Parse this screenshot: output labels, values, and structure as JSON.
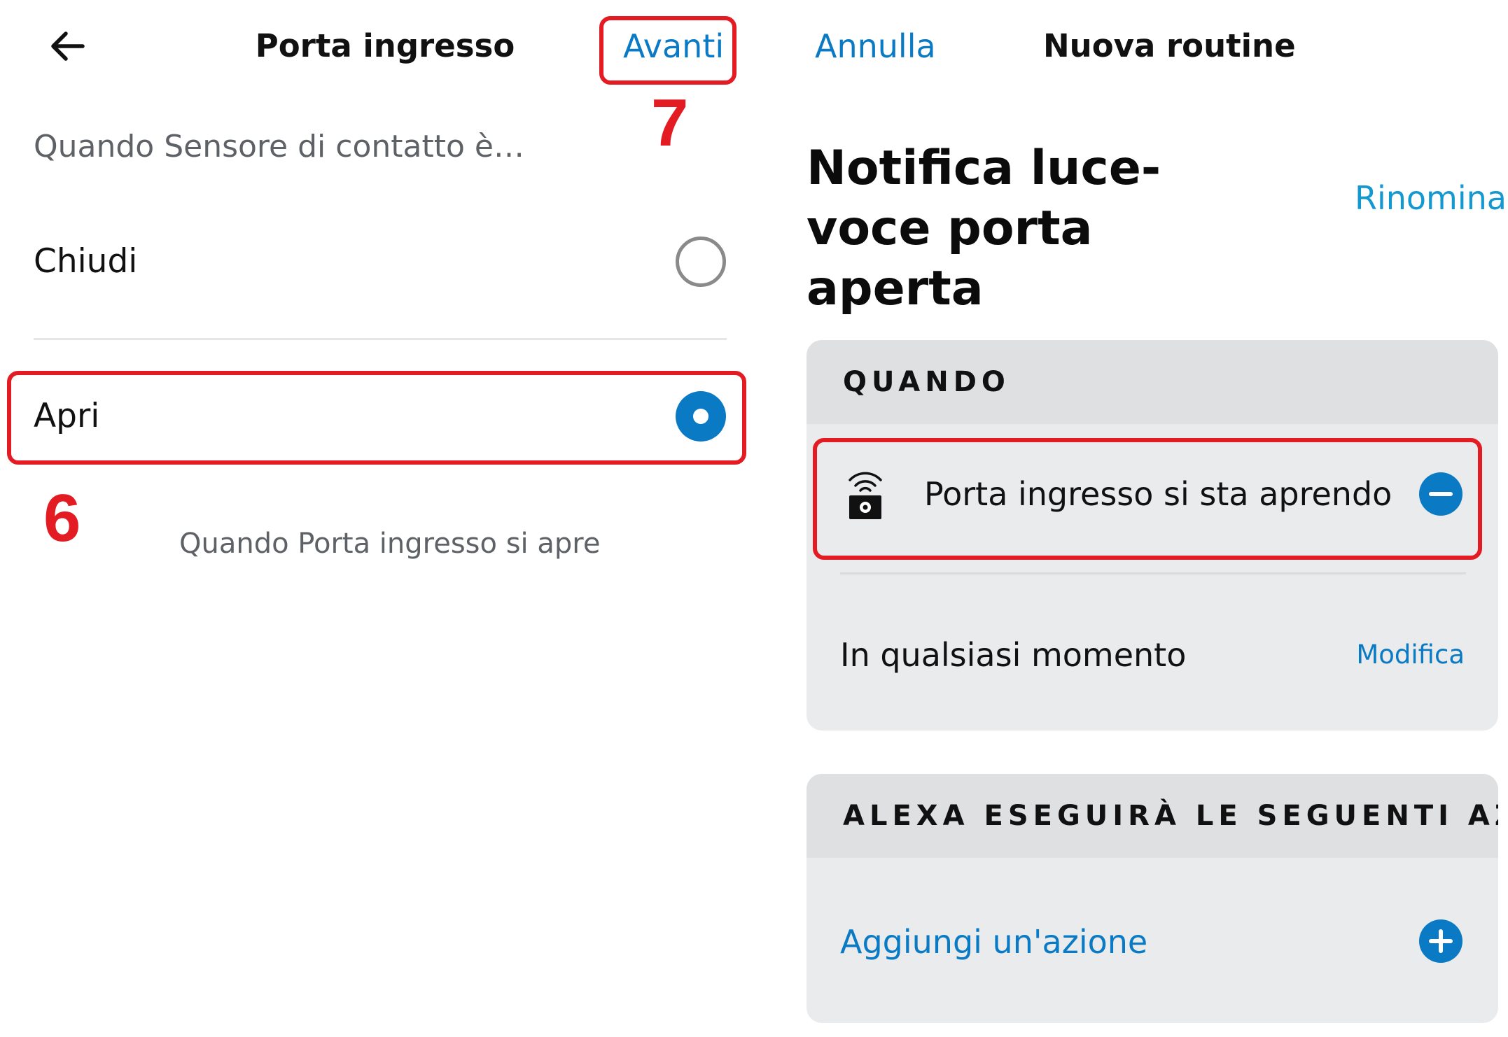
{
  "left_screen": {
    "header": {
      "back_icon": "arrow-left-icon",
      "title": "Porta ingresso",
      "next_label": "Avanti"
    },
    "question": "Quando Sensore di contatto è…",
    "options": [
      {
        "label": "Chiudi",
        "selected": false
      },
      {
        "label": "Apri",
        "selected": true
      }
    ],
    "caption": "Quando Porta ingresso si apre"
  },
  "annotations": {
    "step_6": "6",
    "step_7": "7",
    "highlight_color": "#e31b23"
  },
  "right_screen": {
    "header": {
      "cancel_label": "Annulla",
      "title": "Nuova routine"
    },
    "routine_name": "Notifica luce-voce porta aperta",
    "rename_label": "Rinomina",
    "when_section": {
      "heading": "QUANDO",
      "trigger": {
        "icon": "contact-sensor-icon",
        "text": "Porta ingresso si sta aprendo",
        "remove_icon": "minus-circle-icon"
      },
      "schedule": {
        "text": "In qualsiasi momento",
        "edit_label": "Modifica"
      }
    },
    "actions_section": {
      "heading": "ALEXA ESEGUIRÀ LE SEGUENTI AZI…",
      "add_label": "Aggiungi un'azione",
      "add_icon": "plus-circle-icon"
    }
  },
  "colors": {
    "accent_blue": "#0a7ac4",
    "link_cyan": "#1399cf",
    "card_bg": "#eaebec",
    "card_header_bg": "#dfe0e2"
  }
}
